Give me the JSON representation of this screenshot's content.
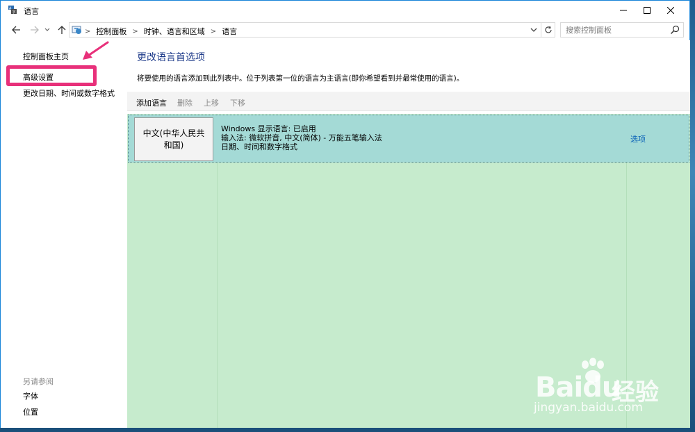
{
  "window": {
    "title": "语言"
  },
  "address": {
    "crumbs": [
      "控制面板",
      "时钟、语言和区域",
      "语言"
    ],
    "search_placeholder": "搜索控制面板"
  },
  "sidebar": {
    "home": "控制面板主页",
    "advanced": "高级设置",
    "change_date": "更改日期、时间或数字格式",
    "see_also": "另请参阅",
    "fonts": "字体",
    "location": "位置"
  },
  "main": {
    "heading": "更改语言首选项",
    "description": "将要使用的语言添加到此列表中。位于列表第一位的语言为主语言(即你希望看到并最常使用的语言)。",
    "toolbar": {
      "add": "添加语言",
      "remove": "删除",
      "up": "上移",
      "down": "下移"
    },
    "languages": [
      {
        "name": "中文(中华人民共和国)",
        "display": "Windows 显示语言: 已启用",
        "input": "输入法: 微软拼音, 中文(简体) - 万能五笔输入法",
        "format": "日期、时间和数字格式",
        "options": "选项"
      }
    ]
  },
  "watermark": {
    "brand": "Bai",
    "brand2": "du",
    "cn": "经验",
    "url": "jingyan.baidu.com"
  },
  "colors": {
    "accent_link": "#0b63b8",
    "heading": "#1e3b8a",
    "list_bg": "#c6ebcd",
    "selected_row": "#a4dad6",
    "highlight": "#e8307a"
  }
}
